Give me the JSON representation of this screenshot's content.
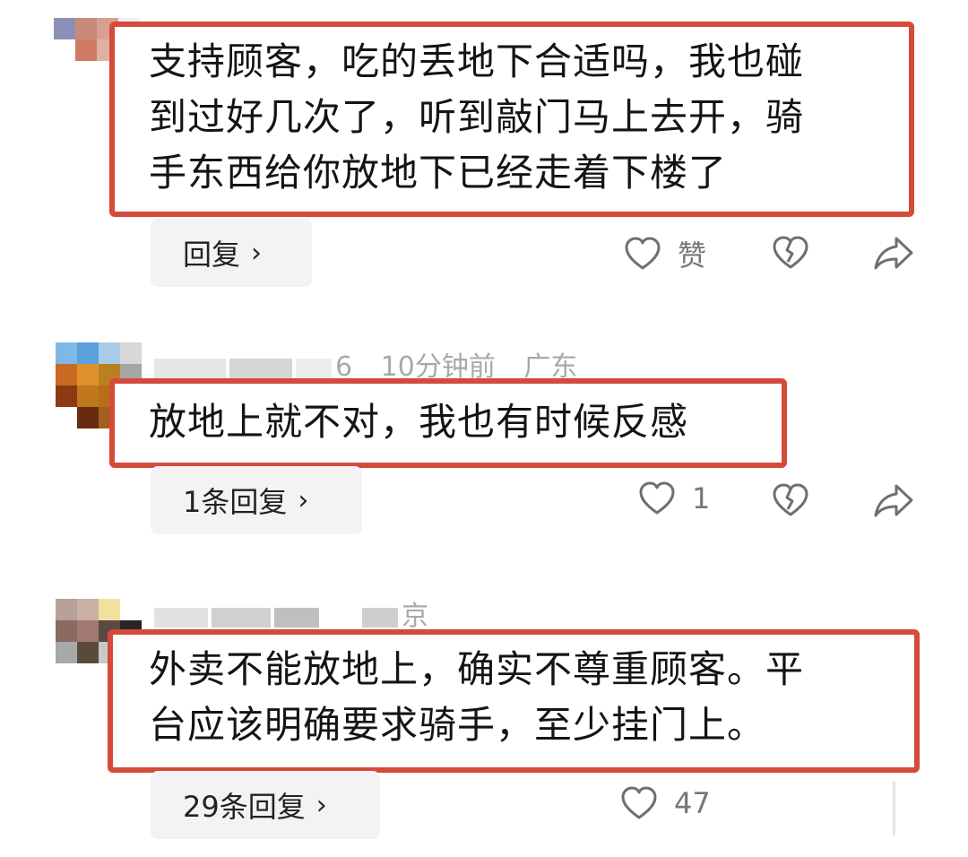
{
  "comments": [
    {
      "text": "支持顾客，吃的丢地下合适吗，我也碰\n到过好几次了，听到敲门马上去开，骑\n手东西给你放地下已经走着下楼了",
      "reply_label": "回复",
      "like_label": "赞"
    },
    {
      "meta": {
        "username_partial": "6",
        "time": "10分钟前",
        "location": "广东"
      },
      "text": "放地上就不对，我也有时候反感",
      "reply_label": "1条回复",
      "like_count": "1"
    },
    {
      "meta": {
        "location_partial": "京"
      },
      "text": "外卖不能放地上，确实不尊重顾客。平\n台应该明确要求骑手，至少挂门上。",
      "reply_label": "29条回复",
      "like_count": "47"
    }
  ],
  "icons": {
    "chevron": "›",
    "like": "heart-outline-icon",
    "dislike": "broken-heart-icon",
    "share": "share-arrow-icon"
  },
  "colors": {
    "highlight_border": "#d54a3a",
    "meta_text": "#a9a9a9",
    "pill_bg": "#f3f3f3"
  }
}
